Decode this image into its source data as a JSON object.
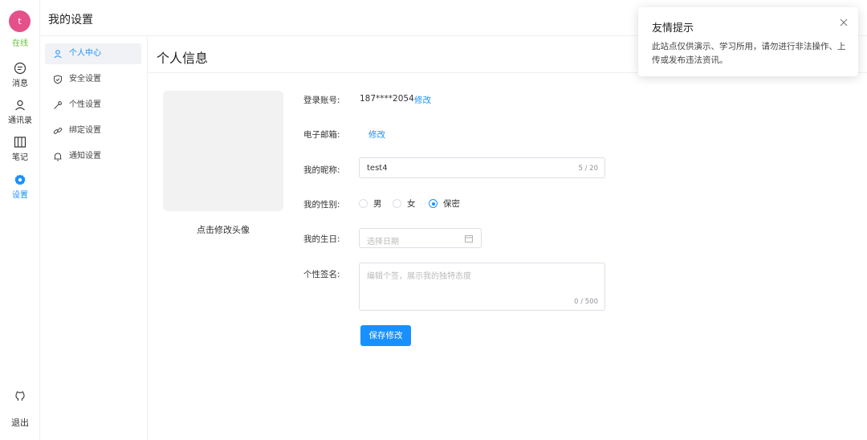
{
  "rail": {
    "avatar_letter": "t",
    "status": "在线",
    "items": [
      {
        "label": "消息",
        "icon": "message-icon"
      },
      {
        "label": "通讯录",
        "icon": "contacts-icon"
      },
      {
        "label": "笔记",
        "icon": "notes-icon"
      },
      {
        "label": "设置",
        "icon": "gear-icon",
        "active": true
      }
    ],
    "logout": "退出",
    "github_icon": "github-icon"
  },
  "header": {
    "title": "我的设置"
  },
  "menu": {
    "items": [
      {
        "label": "个人中心",
        "icon": "user-icon",
        "active": true
      },
      {
        "label": "安全设置",
        "icon": "shield-icon"
      },
      {
        "label": "个性设置",
        "icon": "wrench-icon"
      },
      {
        "label": "绑定设置",
        "icon": "link-icon"
      },
      {
        "label": "通知设置",
        "icon": "bell-icon"
      }
    ]
  },
  "content": {
    "title": "个人信息",
    "avatar_caption": "点击修改头像",
    "form": {
      "account_label": "登录账号:",
      "account_value": "187****2054",
      "account_edit": "修改",
      "email_label": "电子邮箱:",
      "email_edit": "修改",
      "nickname_label": "我的昵称:",
      "nickname_value": "test4",
      "nickname_count": "5 / 20",
      "gender_label": "我的性别:",
      "gender_options": [
        "男",
        "女",
        "保密"
      ],
      "gender_selected": "保密",
      "birthday_label": "我的生日:",
      "birthday_placeholder": "选择日期",
      "signature_label": "个性签名:",
      "signature_placeholder": "编辑个签，展示我的独特态度",
      "signature_count": "0 / 500",
      "save_button": "保存修改"
    }
  },
  "toast": {
    "title": "友情提示",
    "body": "此站点仅供演示、学习所用，请勿进行非法操作、上传或发布违法资讯。"
  },
  "colors": {
    "accent": "#1890ff",
    "online": "#67c23a",
    "avatar": "#e4508a"
  }
}
